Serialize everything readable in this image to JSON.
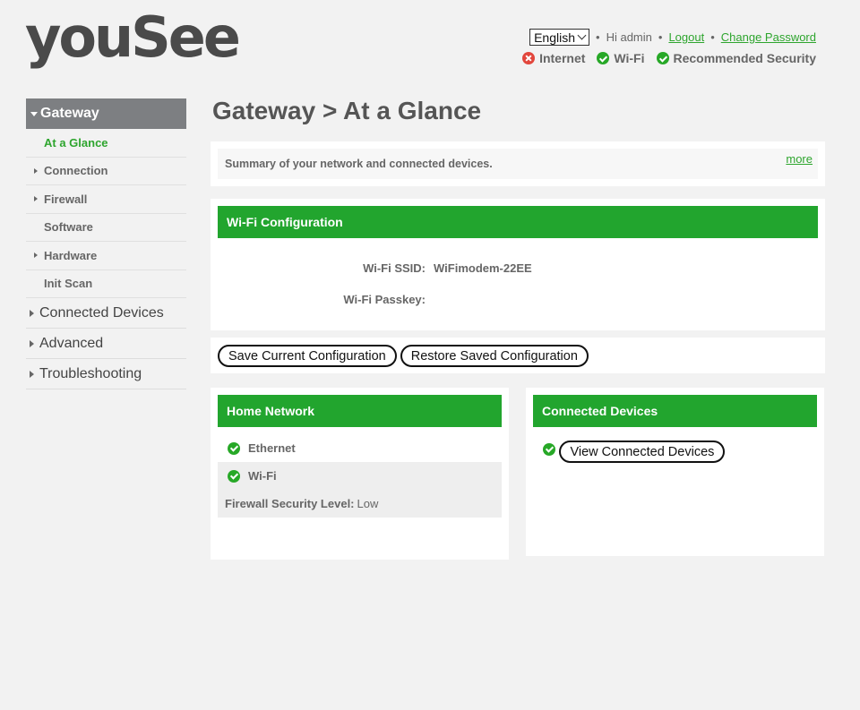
{
  "logo": {
    "text": "youSee"
  },
  "topbar": {
    "language": "English",
    "greeting": "Hi admin",
    "logout": "Logout",
    "change_password": "Change Password",
    "status": [
      {
        "label": "Internet",
        "state": "error",
        "icon": "x-circle-icon"
      },
      {
        "label": "Wi-Fi",
        "state": "ok",
        "icon": "check-circle-icon"
      },
      {
        "label": "Recommended Security",
        "state": "ok",
        "icon": "check-circle-icon"
      }
    ]
  },
  "sidebar": {
    "active_section": "Gateway",
    "sub_items": [
      {
        "label": "At a Glance",
        "active": true
      },
      {
        "label": "Connection",
        "expandable": true
      },
      {
        "label": "Firewall",
        "expandable": true
      },
      {
        "label": "Software"
      },
      {
        "label": "Hardware",
        "expandable": true
      },
      {
        "label": "Init Scan"
      }
    ],
    "top_items": [
      "Connected Devices",
      "Advanced",
      "Troubleshooting"
    ]
  },
  "page": {
    "title": "Gateway > At a Glance"
  },
  "summary": {
    "text": "Summary of your network and connected devices.",
    "more": "more"
  },
  "wifi_config": {
    "heading": "Wi-Fi Configuration",
    "ssid_label": "Wi-Fi SSID:",
    "ssid_value": "WiFimodem-22EE",
    "passkey_label": "Wi-Fi Passkey:",
    "passkey_value": ""
  },
  "buttons": {
    "save": "Save Current Configuration",
    "restore": "Restore Saved Configuration"
  },
  "home_network": {
    "heading": "Home Network",
    "ethernet": "Ethernet",
    "wifi": "Wi-Fi",
    "firewall_label": "Firewall Security Level:",
    "firewall_value": "Low"
  },
  "connected_devices": {
    "heading": "Connected Devices",
    "button": "View Connected Devices"
  },
  "colors": {
    "accent": "#22a52e",
    "nav_active_bg": "#7d7f82",
    "error": "#e2463c"
  }
}
